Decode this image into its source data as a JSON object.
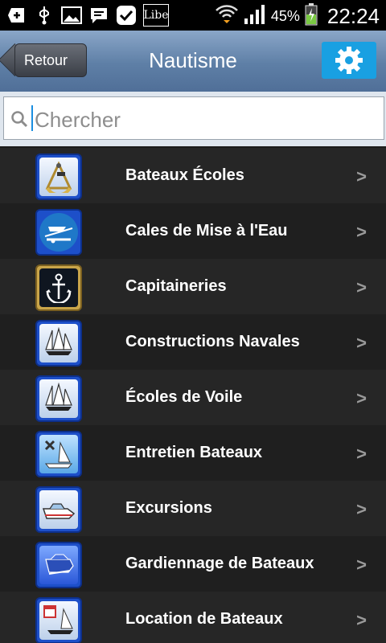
{
  "status_bar": {
    "battery_percent": "45%",
    "time": "22:24",
    "icons": [
      "add-icon",
      "usb-icon",
      "image-icon",
      "chat-icon",
      "check-icon",
      "libe-icon",
      "wifi-icon",
      "signal-icon",
      "battery-icon"
    ],
    "libe_text": "Libe"
  },
  "header": {
    "back_label": "Retour",
    "title": "Nautisme",
    "settings_icon": "gear-icon",
    "accent": "#19a0e2"
  },
  "search": {
    "placeholder": "Chercher"
  },
  "items": [
    {
      "label": "Bateaux Écoles",
      "icon": "sextant-icon"
    },
    {
      "label": "Cales de Mise à l'Eau",
      "icon": "boat-trailer-icon"
    },
    {
      "label": "Capitaineries",
      "icon": "anchor-icon"
    },
    {
      "label": "Constructions Navales",
      "icon": "sailboat-icon"
    },
    {
      "label": "Écoles de Voile",
      "icon": "sailboat-icon"
    },
    {
      "label": "Entretien Bateaux",
      "icon": "tools-sailboat-icon"
    },
    {
      "label": "Excursions",
      "icon": "motorboat-icon"
    },
    {
      "label": "Gardiennage de Bateaux",
      "icon": "covered-boat-icon"
    },
    {
      "label": "Location de Bateaux",
      "icon": "calendar-sailboat-icon"
    }
  ]
}
